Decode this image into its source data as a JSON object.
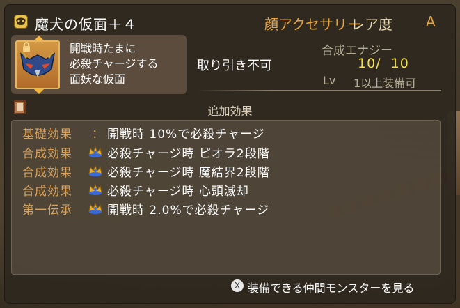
{
  "title_bar": {
    "item_icon": "mask-item-icon",
    "item_name": "魔犬の仮面＋４",
    "category": "顔アクセサリー",
    "rarity_label": "レア度",
    "rarity_value": "A"
  },
  "item_card": {
    "description_lines": [
      "開戦時たまに",
      "必殺チャージする",
      "面妖な仮面"
    ]
  },
  "info": {
    "trade_status": "取り引き不可",
    "energy_label": "合成エナジー",
    "energy_value": "10/  10",
    "level_label": "Lv",
    "level_requirement": "1以上装備可"
  },
  "effects": {
    "section_title": "追加効果",
    "rows": [
      {
        "label": "基礎効果",
        "has_colon": true,
        "colon": "：",
        "text": "開戦時 10%で必殺チャージ"
      },
      {
        "label": "合成効果",
        "has_colon": false,
        "text": "必殺チャージ時 ピオラ2段階"
      },
      {
        "label": "合成効果",
        "has_colon": false,
        "text": "必殺チャージ時 魔結界2段階"
      },
      {
        "label": "合成効果",
        "has_colon": false,
        "text": "必殺チャージ時 心頭滅却"
      },
      {
        "label": "第一伝承",
        "has_colon": false,
        "text": "開戦時 2.0%で必殺チャージ"
      }
    ]
  },
  "footer": {
    "button_glyph": "X",
    "action_label": "装備できる仲間モンスターを見る"
  },
  "colors": {
    "accent_orange": "#e8a53a",
    "energy_yellow": "#f2e04a",
    "effect_label": "#d6a05a"
  }
}
